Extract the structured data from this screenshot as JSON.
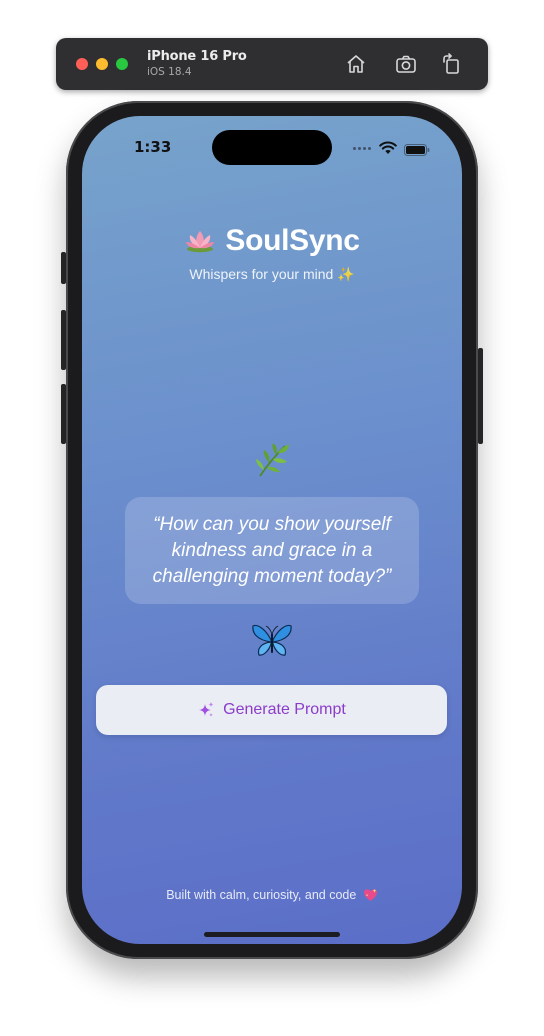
{
  "simulator": {
    "device_name": "iPhone 16 Pro",
    "os_version": "iOS 18.4",
    "icons": [
      "home-icon",
      "screenshot-icon",
      "rotate-icon"
    ]
  },
  "status_bar": {
    "time": "1:33",
    "icons": [
      "wifi-icon",
      "battery-icon"
    ]
  },
  "app": {
    "title_emoji": "lotus-icon",
    "title": "SoulSync",
    "subtitle": "Whispers for your mind ✨",
    "top_icon": "herb-icon",
    "prompt": "“How can you show yourself kindness and grace in a challenging moment today?”",
    "bottom_icon": "butterfly-icon",
    "button": {
      "icon": "sparkles-icon",
      "label": "Generate Prompt"
    },
    "footer": "Built with calm, curiosity, and code",
    "footer_icon": "sparkling-heart-icon"
  },
  "colors": {
    "gradient_top": "#77a3cb",
    "gradient_bottom": "#5b6ec8",
    "button_text": "#8b3cc9",
    "button_bg": "#eaedf4"
  }
}
